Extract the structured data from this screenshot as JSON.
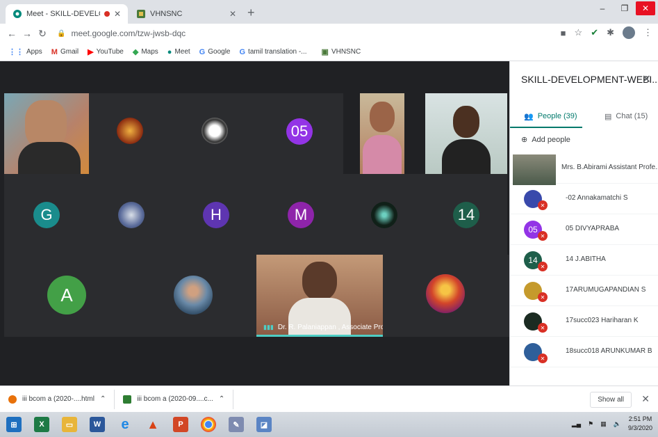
{
  "browser": {
    "tabs": [
      {
        "title": "Meet - SKILL-DEVELOPMENT",
        "recording": true
      },
      {
        "title": "VHNSNC"
      }
    ],
    "url": "meet.google.com/tzw-jwsb-dqc",
    "bookmarks": [
      "Apps",
      "Gmail",
      "YouTube",
      "Maps",
      "Meet",
      "Google",
      "tamil translation -...",
      "VHNSNC"
    ]
  },
  "meeting": {
    "tiles": [
      {
        "kind": "video",
        "label": ""
      },
      {
        "kind": "photo",
        "label": ""
      },
      {
        "kind": "photo",
        "label": ""
      },
      {
        "kind": "initial",
        "text": "05",
        "color": "#9334e6"
      },
      {
        "kind": "video",
        "label": ""
      },
      {
        "kind": "video",
        "label": ""
      },
      {
        "kind": "initial",
        "text": "G",
        "color": "#1a8c8c"
      },
      {
        "kind": "photo",
        "label": ""
      },
      {
        "kind": "initial",
        "text": "H",
        "color": "#5e35b1"
      },
      {
        "kind": "initial",
        "text": "M",
        "color": "#8e24aa"
      },
      {
        "kind": "photo",
        "label": ""
      },
      {
        "kind": "initial",
        "text": "14",
        "color": "#1e5e4a"
      },
      {
        "kind": "initial",
        "text": "A",
        "color": "#43a047"
      },
      {
        "kind": "photo",
        "label": ""
      },
      {
        "kind": "video",
        "label": "Dr. R. Palaniappan , Associate Pro..."
      },
      {
        "kind": "photo",
        "label": ""
      }
    ]
  },
  "panel": {
    "title": "SKILL-DEVELOPMENT-WEBI...",
    "people_tab": "People (39)",
    "chat_tab": "Chat (15)",
    "add_people": "Add people",
    "participants": [
      {
        "name": "Mrs. B.Abirami Assistant Profe...",
        "avatar": "",
        "color": "#6d7a6a"
      },
      {
        "name": "-02 Annakamatchi S",
        "avatar": "",
        "color": "#3949ab"
      },
      {
        "name": "05 DIVYAPRABA",
        "avatar": "05",
        "color": "#9334e6"
      },
      {
        "name": "14 J.ABITHA",
        "avatar": "14",
        "color": "#1e5e4a"
      },
      {
        "name": "17ARUMUGAPANDIAN S",
        "avatar": "",
        "color": "#c59a2c"
      },
      {
        "name": "17succ023 Hariharan K",
        "avatar": "",
        "color": "#1b2b22"
      },
      {
        "name": "18succ018 ARUNKUMAR B",
        "avatar": "",
        "color": "#2f5f9a"
      }
    ]
  },
  "downloads": {
    "items": [
      "iii bcom a (2020-....html",
      "iii bcom a (2020-09....c..."
    ],
    "show_all": "Show all"
  },
  "taskbar": {
    "time": "2:51 PM",
    "date": "9/3/2020"
  }
}
